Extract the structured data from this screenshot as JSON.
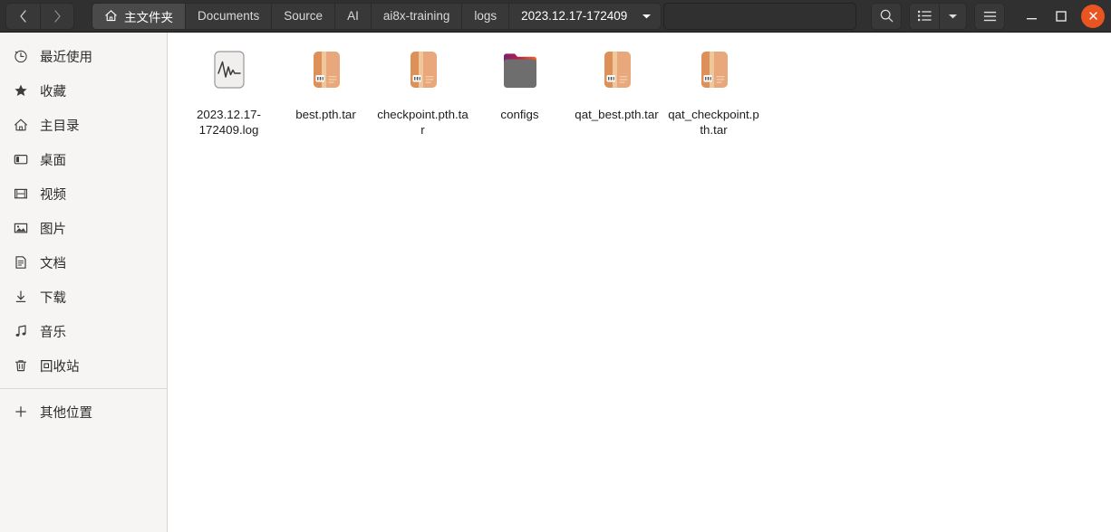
{
  "window": {
    "title": "2023.12.17-172409",
    "accent_color": "#e95420",
    "header_bg": "#303030",
    "sidebar_bg": "#f6f5f4"
  },
  "nav": {
    "back_label": "‹",
    "back_icon": "chevron-left-icon",
    "forward_label": "›",
    "forward_icon": "chevron-right-icon"
  },
  "breadcrumb": {
    "home_icon": "home-icon",
    "items": [
      {
        "label": "主文件夹",
        "state": "home"
      },
      {
        "label": "Documents",
        "state": "normal"
      },
      {
        "label": "Source",
        "state": "normal"
      },
      {
        "label": "AI",
        "state": "normal"
      },
      {
        "label": "ai8x-training",
        "state": "normal"
      },
      {
        "label": "logs",
        "state": "normal"
      },
      {
        "label": "2023.12.17-172409",
        "state": "current"
      }
    ],
    "current_caret_icon": "chevron-down-icon"
  },
  "toolbar": {
    "search_icon": "search-icon",
    "view_list_icon": "list-view-icon",
    "view_dropdown_icon": "chevron-down-icon",
    "menu_icon": "hamburger-menu-icon"
  },
  "window_controls": {
    "minimize_icon": "minimize-icon",
    "maximize_icon": "maximize-icon",
    "close_icon": "close-icon"
  },
  "sidebar": {
    "items": [
      {
        "label": "最近使用",
        "icon": "clock-icon",
        "name": "recent"
      },
      {
        "label": "收藏",
        "icon": "star-icon",
        "name": "starred"
      },
      {
        "label": "主目录",
        "icon": "home-icon",
        "name": "home"
      },
      {
        "label": "桌面",
        "icon": "desktop-icon",
        "name": "desktop"
      },
      {
        "label": "视频",
        "icon": "film-icon",
        "name": "videos"
      },
      {
        "label": "图片",
        "icon": "image-icon",
        "name": "pictures"
      },
      {
        "label": "文档",
        "icon": "document-icon",
        "name": "documents"
      },
      {
        "label": "下载",
        "icon": "download-icon",
        "name": "downloads"
      },
      {
        "label": "音乐",
        "icon": "music-icon",
        "name": "music"
      },
      {
        "label": "回收站",
        "icon": "trash-icon",
        "name": "trash"
      }
    ],
    "other_locations": {
      "label": "其他位置",
      "icon": "plus-icon",
      "name": "other-locations"
    }
  },
  "files": [
    {
      "name": "2023.12.17-172409.log",
      "type": "log",
      "icon": "log-file-icon"
    },
    {
      "name": "best.pth.tar",
      "type": "archive",
      "icon": "archive-file-icon"
    },
    {
      "name": "checkpoint.pth.tar",
      "type": "archive",
      "icon": "archive-file-icon"
    },
    {
      "name": "configs",
      "type": "folder",
      "icon": "folder-icon"
    },
    {
      "name": "qat_best.pth.tar",
      "type": "archive",
      "icon": "archive-file-icon"
    },
    {
      "name": "qat_checkpoint.pth.tar",
      "type": "archive",
      "icon": "archive-file-icon"
    }
  ]
}
